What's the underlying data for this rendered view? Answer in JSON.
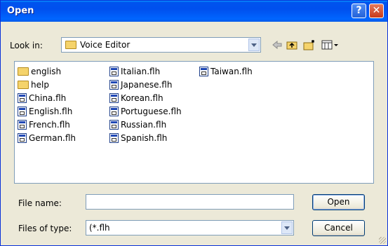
{
  "window": {
    "title": "Open",
    "help_glyph": "?",
    "close_glyph": "✕"
  },
  "lookin": {
    "label": "Look in:",
    "value": "Voice Editor",
    "tools": [
      "back-icon",
      "up-folder-icon",
      "new-folder-icon",
      "view-menu-icon"
    ]
  },
  "files": {
    "columns": [
      [
        {
          "name": "english",
          "type": "folder"
        },
        {
          "name": "help",
          "type": "folder"
        },
        {
          "name": "China.flh",
          "type": "file"
        },
        {
          "name": "English.flh",
          "type": "file"
        },
        {
          "name": "French.flh",
          "type": "file"
        },
        {
          "name": "German.flh",
          "type": "file"
        }
      ],
      [
        {
          "name": "Italian.flh",
          "type": "file"
        },
        {
          "name": "Japanese.flh",
          "type": "file"
        },
        {
          "name": "Korean.flh",
          "type": "file"
        },
        {
          "name": "Portuguese.flh",
          "type": "file"
        },
        {
          "name": "Russian.flh",
          "type": "file"
        },
        {
          "name": "Spanish.flh",
          "type": "file"
        }
      ],
      [
        {
          "name": "Taiwan.flh",
          "type": "file"
        }
      ]
    ]
  },
  "filename": {
    "label": "File name:",
    "value": ""
  },
  "filetype": {
    "label": "Files of type:",
    "value": "(*.flh"
  },
  "buttons": {
    "open": "Open",
    "cancel": "Cancel"
  }
}
